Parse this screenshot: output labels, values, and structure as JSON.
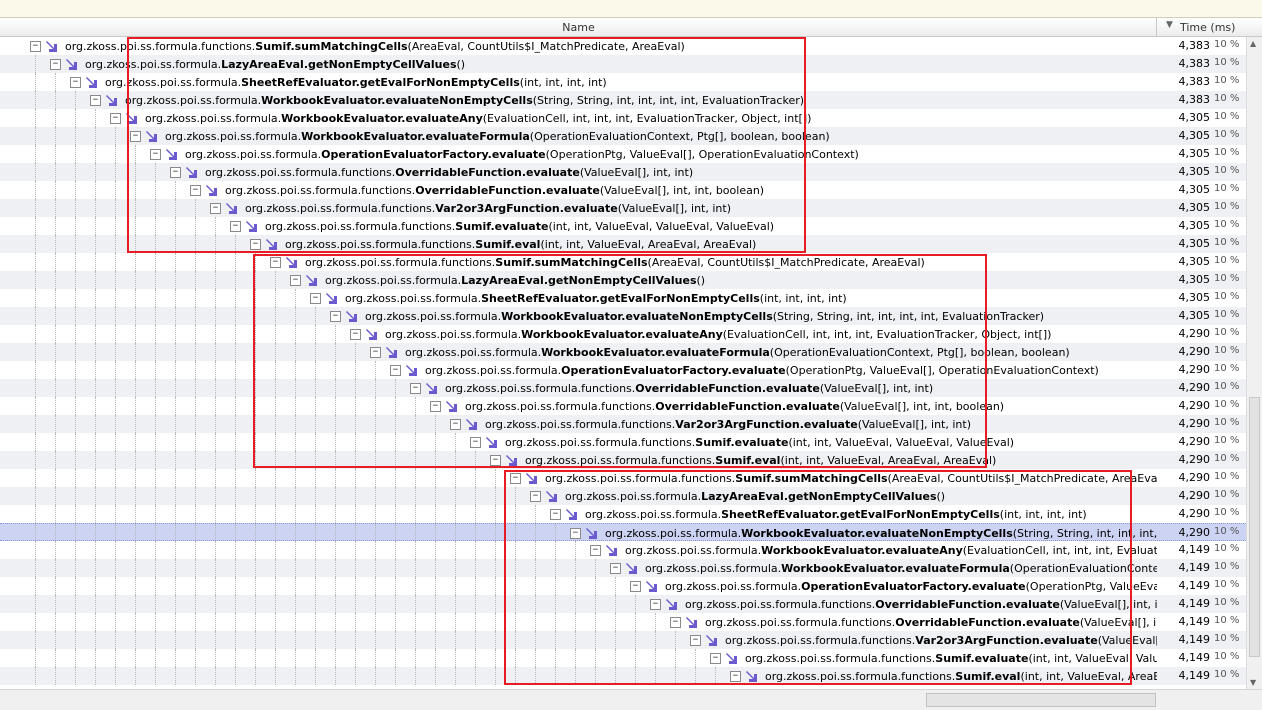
{
  "columns": {
    "name": "Name",
    "time": "Time (ms)",
    "sort_icon": "sort-descending-icon"
  },
  "colors": {
    "highlight_box": "#e81c24",
    "selected_row": "#cdd3f3",
    "alt_row": "#eef0f3",
    "method_arrow_icon": "#6a5acd"
  },
  "rows": [
    {
      "depth": 0,
      "prefix": "org.zkoss.poi.ss.formula.functions.",
      "method": "Sumif.sumMatchingCells",
      "args": "(AreaEval, CountUtils$I_MatchPredicate, AreaEval)",
      "time": "4,383",
      "pct": "10 %"
    },
    {
      "depth": 1,
      "prefix": "org.zkoss.poi.ss.formula.",
      "method": "LazyAreaEval.getNonEmptyCellValues",
      "args": "()",
      "time": "4,383",
      "pct": "10 %"
    },
    {
      "depth": 2,
      "prefix": "org.zkoss.poi.ss.formula.",
      "method": "SheetRefEvaluator.getEvalForNonEmptyCells",
      "args": "(int, int, int, int)",
      "time": "4,383",
      "pct": "10 %"
    },
    {
      "depth": 3,
      "prefix": "org.zkoss.poi.ss.formula.",
      "method": "WorkbookEvaluator.evaluateNonEmptyCells",
      "args": "(String, String, int, int, int, int, EvaluationTracker)",
      "time": "4,383",
      "pct": "10 %"
    },
    {
      "depth": 4,
      "prefix": "org.zkoss.poi.ss.formula.",
      "method": "WorkbookEvaluator.evaluateAny",
      "args": "(EvaluationCell, int, int, int, EvaluationTracker, Object, int[])",
      "time": "4,305",
      "pct": "10 %"
    },
    {
      "depth": 5,
      "prefix": "org.zkoss.poi.ss.formula.",
      "method": "WorkbookEvaluator.evaluateFormula",
      "args": "(OperationEvaluationContext, Ptg[], boolean, boolean)",
      "time": "4,305",
      "pct": "10 %"
    },
    {
      "depth": 6,
      "prefix": "org.zkoss.poi.ss.formula.",
      "method": "OperationEvaluatorFactory.evaluate",
      "args": "(OperationPtg, ValueEval[], OperationEvaluationContext)",
      "time": "4,305",
      "pct": "10 %"
    },
    {
      "depth": 7,
      "prefix": "org.zkoss.poi.ss.formula.functions.",
      "method": "OverridableFunction.evaluate",
      "args": "(ValueEval[], int, int)",
      "time": "4,305",
      "pct": "10 %"
    },
    {
      "depth": 8,
      "prefix": "org.zkoss.poi.ss.formula.functions.",
      "method": "OverridableFunction.evaluate",
      "args": "(ValueEval[], int, int, boolean)",
      "time": "4,305",
      "pct": "10 %"
    },
    {
      "depth": 9,
      "prefix": "org.zkoss.poi.ss.formula.functions.",
      "method": "Var2or3ArgFunction.evaluate",
      "args": "(ValueEval[], int, int)",
      "time": "4,305",
      "pct": "10 %"
    },
    {
      "depth": 10,
      "prefix": "org.zkoss.poi.ss.formula.functions.",
      "method": "Sumif.evaluate",
      "args": "(int, int, ValueEval, ValueEval, ValueEval)",
      "time": "4,305",
      "pct": "10 %"
    },
    {
      "depth": 11,
      "prefix": "org.zkoss.poi.ss.formula.functions.",
      "method": "Sumif.eval",
      "args": "(int, int, ValueEval, AreaEval, AreaEval)",
      "time": "4,305",
      "pct": "10 %"
    },
    {
      "depth": 12,
      "prefix": "org.zkoss.poi.ss.formula.functions.",
      "method": "Sumif.sumMatchingCells",
      "args": "(AreaEval, CountUtils$I_MatchPredicate, AreaEval)",
      "time": "4,305",
      "pct": "10 %"
    },
    {
      "depth": 13,
      "prefix": "org.zkoss.poi.ss.formula.",
      "method": "LazyAreaEval.getNonEmptyCellValues",
      "args": "()",
      "time": "4,305",
      "pct": "10 %"
    },
    {
      "depth": 14,
      "prefix": "org.zkoss.poi.ss.formula.",
      "method": "SheetRefEvaluator.getEvalForNonEmptyCells",
      "args": "(int, int, int, int)",
      "time": "4,305",
      "pct": "10 %"
    },
    {
      "depth": 15,
      "prefix": "org.zkoss.poi.ss.formula.",
      "method": "WorkbookEvaluator.evaluateNonEmptyCells",
      "args": "(String, String, int, int, int, int, EvaluationTracker)",
      "time": "4,305",
      "pct": "10 %"
    },
    {
      "depth": 16,
      "prefix": "org.zkoss.poi.ss.formula.",
      "method": "WorkbookEvaluator.evaluateAny",
      "args": "(EvaluationCell, int, int, int, EvaluationTracker, Object, int[])",
      "time": "4,290",
      "pct": "10 %"
    },
    {
      "depth": 17,
      "prefix": "org.zkoss.poi.ss.formula.",
      "method": "WorkbookEvaluator.evaluateFormula",
      "args": "(OperationEvaluationContext, Ptg[], boolean, boolean)",
      "time": "4,290",
      "pct": "10 %"
    },
    {
      "depth": 18,
      "prefix": "org.zkoss.poi.ss.formula.",
      "method": "OperationEvaluatorFactory.evaluate",
      "args": "(OperationPtg, ValueEval[], OperationEvaluationContext)",
      "time": "4,290",
      "pct": "10 %"
    },
    {
      "depth": 19,
      "prefix": "org.zkoss.poi.ss.formula.functions.",
      "method": "OverridableFunction.evaluate",
      "args": "(ValueEval[], int, int)",
      "time": "4,290",
      "pct": "10 %"
    },
    {
      "depth": 20,
      "prefix": "org.zkoss.poi.ss.formula.functions.",
      "method": "OverridableFunction.evaluate",
      "args": "(ValueEval[], int, int, boolean)",
      "time": "4,290",
      "pct": "10 %"
    },
    {
      "depth": 21,
      "prefix": "org.zkoss.poi.ss.formula.functions.",
      "method": "Var2or3ArgFunction.evaluate",
      "args": "(ValueEval[], int, int)",
      "time": "4,290",
      "pct": "10 %"
    },
    {
      "depth": 22,
      "prefix": "org.zkoss.poi.ss.formula.functions.",
      "method": "Sumif.evaluate",
      "args": "(int, int, ValueEval, ValueEval, ValueEval)",
      "time": "4,290",
      "pct": "10 %"
    },
    {
      "depth": 23,
      "prefix": "org.zkoss.poi.ss.formula.functions.",
      "method": "Sumif.eval",
      "args": "(int, int, ValueEval, AreaEval, AreaEval)",
      "time": "4,290",
      "pct": "10 %"
    },
    {
      "depth": 24,
      "prefix": "org.zkoss.poi.ss.formula.functions.",
      "method": "Sumif.sumMatchingCells",
      "args": "(AreaEval, CountUtils$I_MatchPredicate, AreaEval)",
      "time": "4,290",
      "pct": "10 %"
    },
    {
      "depth": 25,
      "prefix": "org.zkoss.poi.ss.formula.",
      "method": "LazyAreaEval.getNonEmptyCellValues",
      "args": "()",
      "time": "4,290",
      "pct": "10 %"
    },
    {
      "depth": 26,
      "prefix": "org.zkoss.poi.ss.formula.",
      "method": "SheetRefEvaluator.getEvalForNonEmptyCells",
      "args": "(int, int, int, int)",
      "time": "4,290",
      "pct": "10 %"
    },
    {
      "depth": 27,
      "prefix": "org.zkoss.poi.ss.formula.",
      "method": "WorkbookEvaluator.evaluateNonEmptyCells",
      "args": "(String, String, int, int, int, int, Eva",
      "time": "4,290",
      "pct": "10 %",
      "selected": true
    },
    {
      "depth": 28,
      "prefix": "org.zkoss.poi.ss.formula.",
      "method": "WorkbookEvaluator.evaluateAny",
      "args": "(EvaluationCell, int, int, int, EvaluationTra",
      "time": "4,149",
      "pct": "10 %"
    },
    {
      "depth": 29,
      "prefix": "org.zkoss.poi.ss.formula.",
      "method": "WorkbookEvaluator.evaluateFormula",
      "args": "(OperationEvaluationContext, Pt",
      "time": "4,149",
      "pct": "10 %"
    },
    {
      "depth": 30,
      "prefix": "org.zkoss.poi.ss.formula.",
      "method": "OperationEvaluatorFactory.evaluate",
      "args": "(OperationPtg, ValueEval[], Op",
      "time": "4,149",
      "pct": "10 %"
    },
    {
      "depth": 31,
      "prefix": "org.zkoss.poi.ss.formula.functions.",
      "method": "OverridableFunction.evaluate",
      "args": "(ValueEval[], int, int)",
      "time": "4,149",
      "pct": "10 %"
    },
    {
      "depth": 32,
      "prefix": "org.zkoss.poi.ss.formula.functions.",
      "method": "OverridableFunction.evaluate",
      "args": "(ValueEval[], int, int",
      "time": "4,149",
      "pct": "10 %"
    },
    {
      "depth": 33,
      "prefix": "org.zkoss.poi.ss.formula.functions.",
      "method": "Var2or3ArgFunction.evaluate",
      "args": "(ValueEval[], int, int",
      "time": "4,149",
      "pct": "10 %"
    },
    {
      "depth": 34,
      "prefix": "org.zkoss.poi.ss.formula.functions.",
      "method": "Sumif.evaluate",
      "args": "(int, int, ValueEval, ValueEv",
      "time": "4,149",
      "pct": "10 %"
    },
    {
      "depth": 35,
      "prefix": "org.zkoss.poi.ss.formula.functions.",
      "method": "Sumif.eval",
      "args": "(int, int, ValueEval, AreaEval",
      "time": "4,149",
      "pct": "10 %"
    }
  ]
}
